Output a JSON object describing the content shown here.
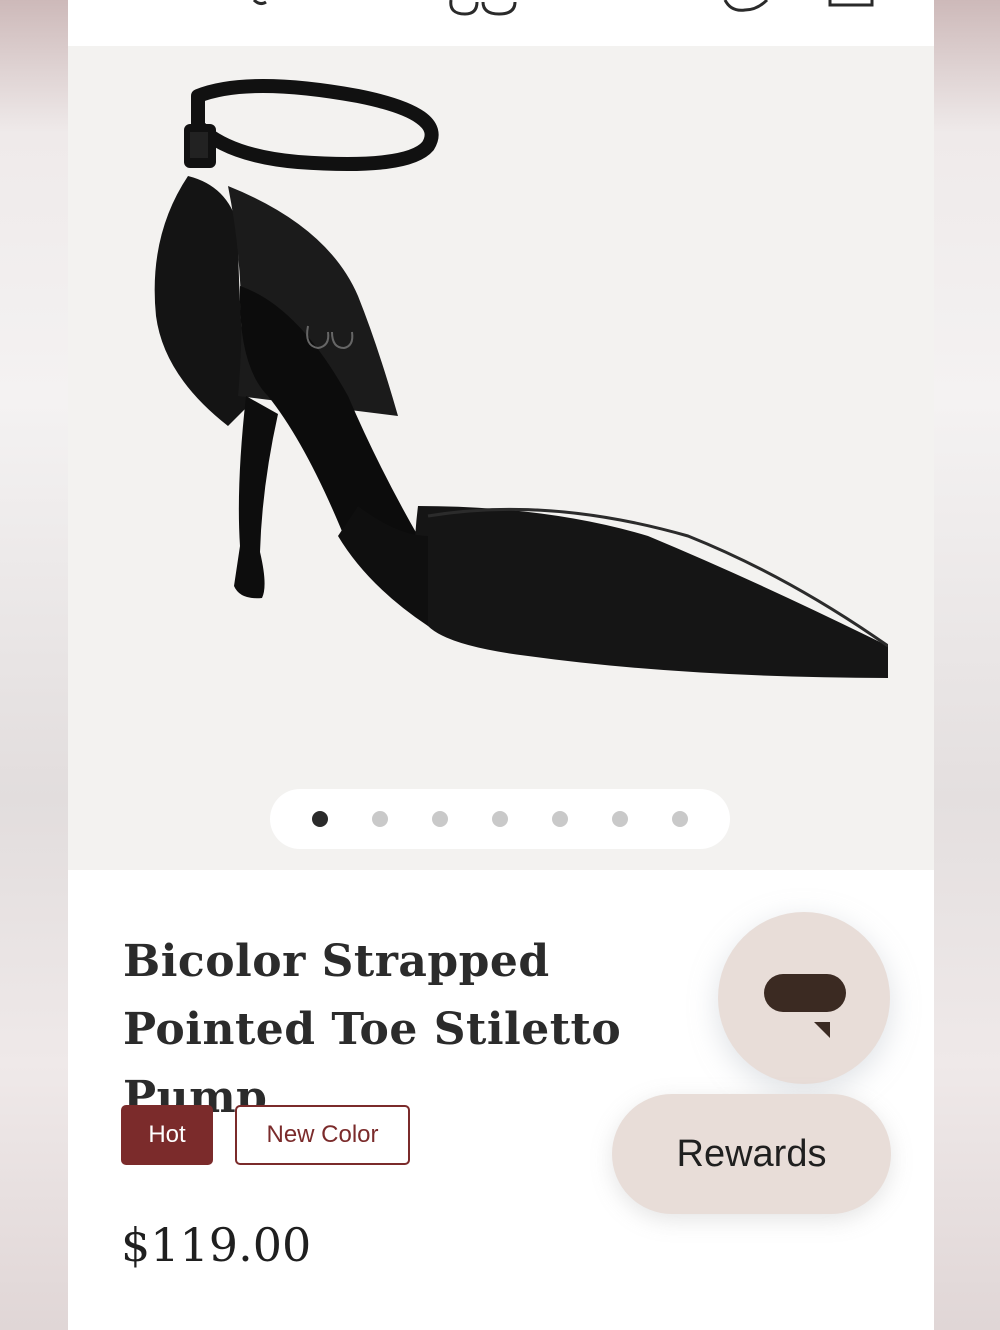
{
  "header": {
    "search_icon": "search-icon",
    "logo_icon": "brand-logo",
    "account_icon": "account-icon",
    "cart_icon": "bag-icon"
  },
  "gallery": {
    "image_alt": "black pointed toe stiletto pump with ankle strap",
    "slide_count": 7,
    "active_slide": 1
  },
  "product": {
    "title": "Bicolor Strapped Pointed Toe Stiletto Pump",
    "badges": [
      "Hot",
      "New Color"
    ],
    "price": "$119.00"
  },
  "floating": {
    "chat_icon": "chat-bubble-icon",
    "rewards_label": "Rewards"
  },
  "colors": {
    "accent": "#7b2b2b",
    "floating_bg": "#e8ddd8",
    "chat_icon": "#3b2a22"
  }
}
